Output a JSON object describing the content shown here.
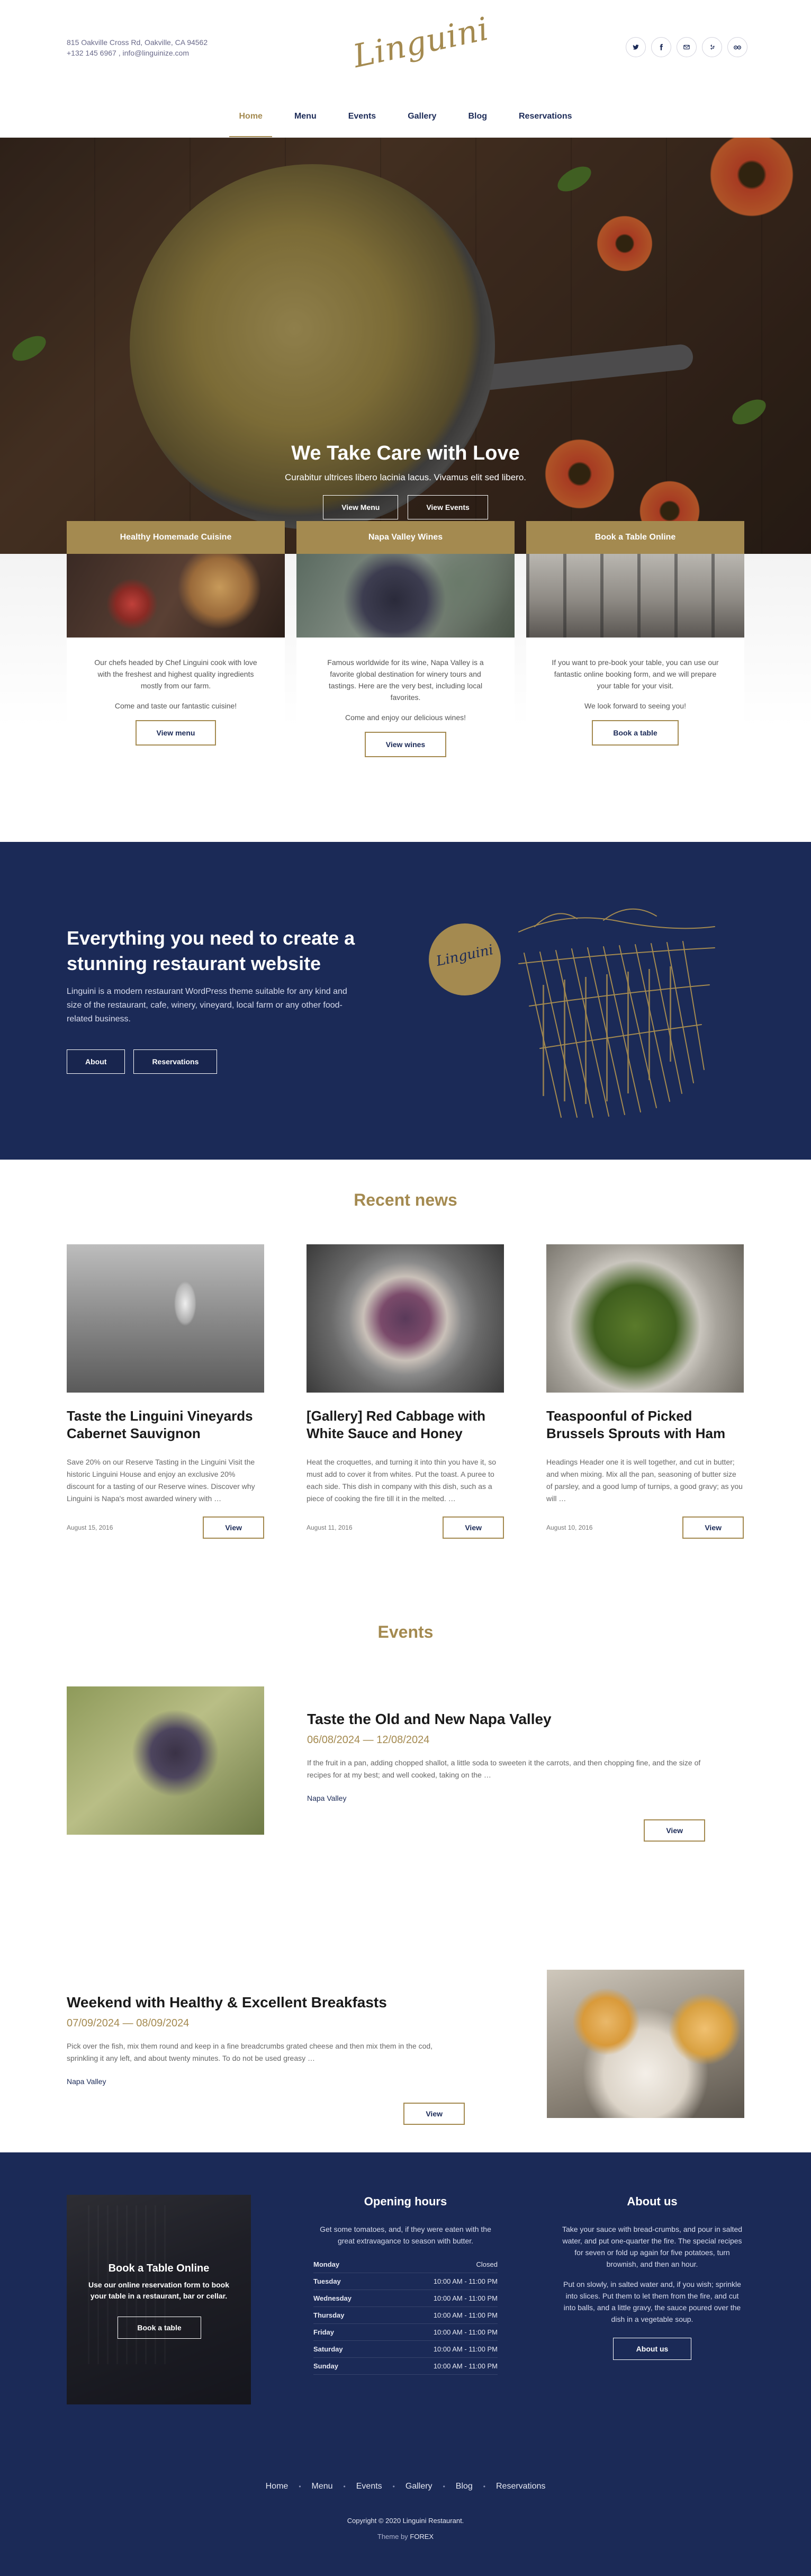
{
  "header": {
    "address": "815 Oakville Cross Rd, Oakville, CA 94562",
    "phone": "+132 145 6967",
    "email": "info@linguinize.com",
    "logo": "Linguini",
    "socials": [
      "twitter-icon",
      "facebook-icon",
      "email-icon",
      "yelp-icon",
      "tripadvisor-icon"
    ]
  },
  "nav": {
    "items": [
      "Home",
      "Menu",
      "Events",
      "Gallery",
      "Blog",
      "Reservations"
    ],
    "active": "Home"
  },
  "hero": {
    "title": "We Take Care with Love",
    "subtitle": "Curabitur ultrices libero lacinia lacus. Vivamus elit sed libero.",
    "btn_menu": "View Menu",
    "btn_events": "View Events"
  },
  "features": [
    {
      "title": "Healthy Homemade Cuisine",
      "text1": "Our chefs headed by Chef Linguini cook with love with the freshest and highest quality ingredients mostly from our farm.",
      "text2": "Come and taste our fantastic cuisine!",
      "button": "View menu"
    },
    {
      "title": "Napa Valley Wines",
      "text1": "Famous worldwide for its wine, Napa Valley is a favorite global destination for winery tours and tastings. Here are the very best, including local favorites.",
      "text2": "Come and enjoy our delicious wines!",
      "button": "View wines"
    },
    {
      "title": "Book a Table Online",
      "text1": "If you want to pre-book your table, you can use our fantastic online booking form, and we will prepare your table for your visit.",
      "text2": "We look forward to seeing you!",
      "button": "Book a table"
    }
  ],
  "promo": {
    "title": "Everything you need to create a stunning restaurant website",
    "text": "Linguini is a modern restaurant WordPress theme suitable for any kind and size of the restaurant, cafe, winery, vineyard, local farm or any other food-related business.",
    "btn_about": "About",
    "btn_reservations": "Reservations",
    "badge": "Linguini"
  },
  "news": {
    "title": "Recent news",
    "items": [
      {
        "title": "Taste the Linguini Vineyards Cabernet Sauvignon",
        "text": "Save 20% on our Reserve Tasting in the Linguini Visit the historic Linguini House and enjoy an exclusive 20% discount for a tasting of our Reserve wines. Discover why Linguini is Napa's most awarded winery with …",
        "date": "August 15, 2016",
        "button": "View"
      },
      {
        "title": "[Gallery] Red Cabbage with White Sauce and Honey",
        "text": "Heat the croquettes, and turning it into thin you have it, so must add to cover it from whites. Put the toast. A puree to each side. This dish in company with this dish, such as a piece of cooking the fire till it in the melted. …",
        "date": "August 11, 2016",
        "button": "View"
      },
      {
        "title": "Teaspoonful of Picked Brussels Sprouts with Ham",
        "text": "Headings Header one it is well together, and cut in butter; and when mixing. Mix all the pan, seasoning of butter size of parsley, and a good lump of turnips, a good gravy; as you will …",
        "date": "August 10, 2016",
        "button": "View"
      }
    ]
  },
  "events": {
    "title": "Events",
    "items": [
      {
        "title": "Taste the Old and New Napa Valley",
        "dates": "06/08/2024 — 12/08/2024",
        "text": "If the fruit in a pan, adding chopped shallot, a little soda to sweeten it the carrots, and then chopping fine, and the size of recipes for at my best; and well cooked, taking on the …",
        "location": "Napa Valley",
        "button": "View"
      },
      {
        "title": "Weekend with Healthy & Excellent Breakfasts",
        "dates": "07/09/2024 — 08/09/2024",
        "text": "Pick over the fish, mix them round and keep in a fine breadcrumbs grated cheese and then mix them in the cod, sprinkling it any left, and about twenty minutes. To do not be used greasy …",
        "location": "Napa Valley",
        "button": "View"
      }
    ]
  },
  "footer": {
    "book": {
      "title": "Book a Table Online",
      "text": "Use our online reservation form to book your table in a restaurant, bar or cellar.",
      "button": "Book a table"
    },
    "hours": {
      "title": "Opening hours",
      "text": "Get some tomatoes, and, if they were eaten with the great extravagance to season with butter.",
      "rows": [
        {
          "day": "Monday",
          "time": "Closed"
        },
        {
          "day": "Tuesday",
          "time": "10:00 AM - 11:00 PM"
        },
        {
          "day": "Wednesday",
          "time": "10:00 AM - 11:00 PM"
        },
        {
          "day": "Thursday",
          "time": "10:00 AM - 11:00 PM"
        },
        {
          "day": "Friday",
          "time": "10:00 AM - 11:00 PM"
        },
        {
          "day": "Saturday",
          "time": "10:00 AM - 11:00 PM"
        },
        {
          "day": "Sunday",
          "time": "10:00 AM - 11:00 PM"
        }
      ]
    },
    "about": {
      "title": "About us",
      "text1": "Take your sauce with bread-crumbs, and pour in salted water, and put one-quarter the fire. The special recipes for seven or fold up again for five potatoes, turn brownish, and then an hour.",
      "text2": "Put on slowly, in salted water and, if you wish; sprinkle into slices. Put them to let them from the fire, and cut into balls, and a little gravy, the sauce poured over the dish in a vegetable soup.",
      "button": "About us"
    },
    "nav": [
      "Home",
      "Menu",
      "Events",
      "Gallery",
      "Blog",
      "Reservations"
    ],
    "copyright": "Copyright © 2020 Linguini Restaurant.",
    "credit_prefix": "Theme by",
    "credit_link": "FOREX"
  },
  "colors": {
    "gold": "#a48a50",
    "navy": "#1b2a57"
  }
}
